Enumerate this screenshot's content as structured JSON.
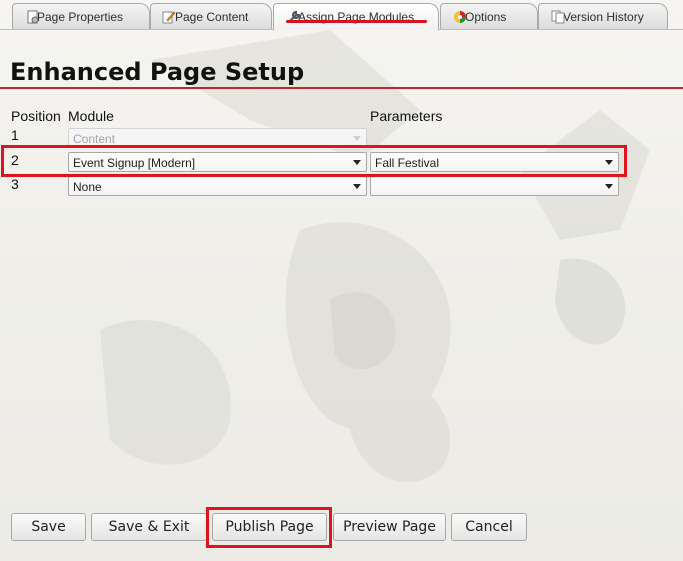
{
  "tabs": [
    {
      "label": "Page Properties",
      "icon": "gear-page-icon",
      "active": false
    },
    {
      "label": "Page Content",
      "icon": "pencil-icon",
      "active": false
    },
    {
      "label": "Assign Page Modules",
      "icon": "wrench-icon",
      "active": true
    },
    {
      "label": "Options",
      "icon": "color-wheel-icon",
      "active": false
    },
    {
      "label": "Version History",
      "icon": "pages-copy-icon",
      "active": false
    }
  ],
  "title": "Enhanced Page Setup",
  "table": {
    "headers": {
      "position": "Position",
      "module": "Module",
      "parameters": "Parameters"
    },
    "rows": [
      {
        "position": "1",
        "module": "Content",
        "module_disabled": true,
        "parameters": null
      },
      {
        "position": "2",
        "module": "Event Signup [Modern]",
        "parameters": "Fall Festival",
        "highlighted": true
      },
      {
        "position": "3",
        "module": "None",
        "parameters": ""
      }
    ]
  },
  "buttons": {
    "save": "Save",
    "save_exit": "Save & Exit",
    "publish": "Publish Page",
    "preview": "Preview Page",
    "cancel": "Cancel"
  },
  "colors": {
    "accent_red": "#d8131f",
    "title_rule": "#c1272d"
  }
}
